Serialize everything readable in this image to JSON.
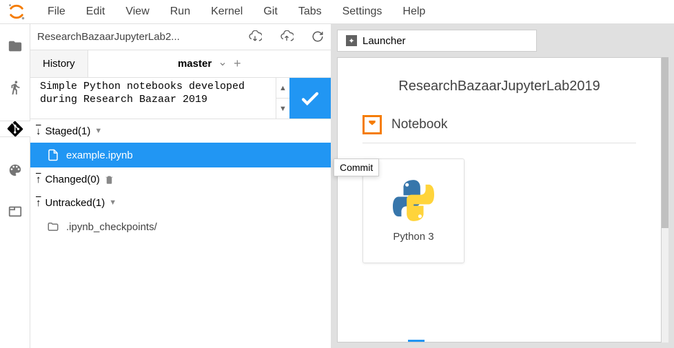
{
  "menubar": [
    "File",
    "Edit",
    "View",
    "Run",
    "Kernel",
    "Git",
    "Tabs",
    "Settings",
    "Help"
  ],
  "git": {
    "repo_name": "ResearchBazaarJupyterLab2...",
    "history_tab": "History",
    "branch": "master",
    "commit_message": "Simple Python notebooks developed during Research Bazaar 2019",
    "staged_header": "Staged(1)",
    "staged_file": "example.ipynb",
    "changed_header": "Changed(0)",
    "untracked_header": "Untracked(1)",
    "untracked_file": ".ipynb_checkpoints/"
  },
  "tooltip": "Commit",
  "launcher": {
    "tab_label": "Launcher",
    "title": "ResearchBazaarJupyterLab2019",
    "section": "Notebook",
    "kernel": "Python 3"
  }
}
